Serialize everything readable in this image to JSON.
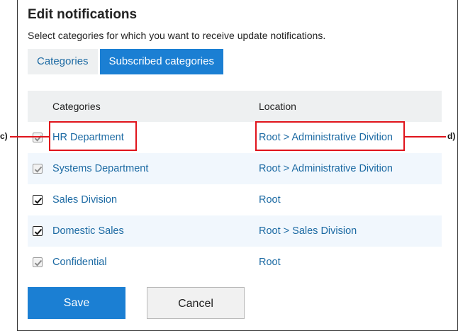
{
  "dialog": {
    "title": "Edit notifications",
    "description": "Select categories for which you want to receive update notifications."
  },
  "tabs": [
    {
      "label": "Categories",
      "active": false
    },
    {
      "label": "Subscribed categories",
      "active": true
    }
  ],
  "table": {
    "headers": {
      "category": "Categories",
      "location": "Location"
    },
    "rows": [
      {
        "category": "HR Department",
        "location": "Root > Administrative Divition",
        "checked": true,
        "disabled": true
      },
      {
        "category": "Systems Department",
        "location": "Root > Administrative Divition",
        "checked": true,
        "disabled": true
      },
      {
        "category": "Sales Division",
        "location": "Root",
        "checked": true,
        "disabled": false
      },
      {
        "category": "Domestic Sales",
        "location": "Root > Sales Division",
        "checked": true,
        "disabled": false
      },
      {
        "category": "Confidential",
        "location": "Root",
        "checked": true,
        "disabled": true
      }
    ]
  },
  "callouts": {
    "c": "c)",
    "d": "d)"
  },
  "buttons": {
    "save": "Save",
    "cancel": "Cancel"
  },
  "colors": {
    "accent": "#1b7fd3",
    "link": "#1c6aa3",
    "callout": "#e0141c"
  }
}
